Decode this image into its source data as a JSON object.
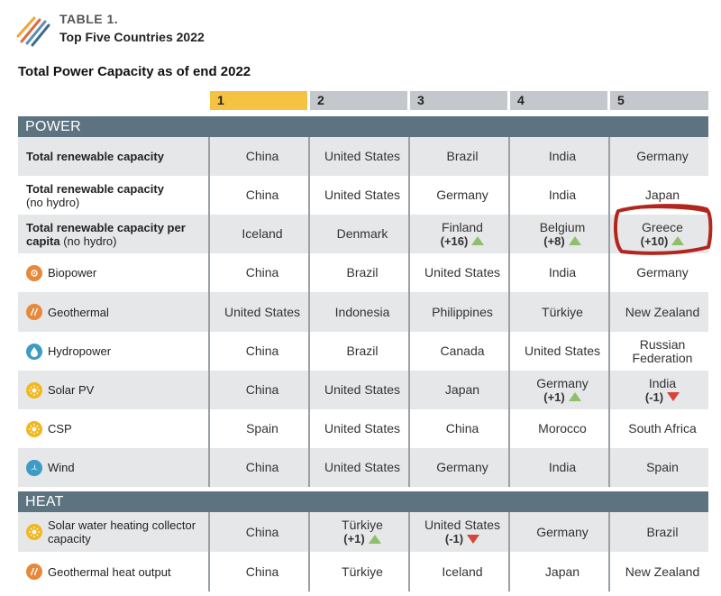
{
  "header": {
    "table_label": "TABLE 1.",
    "table_title": "Top Five Countries 2022",
    "subtitle": "Total Power Capacity as of end 2022"
  },
  "ranks": [
    "1",
    "2",
    "3",
    "4",
    "5"
  ],
  "sections": {
    "power": "POWER",
    "heat": "HEAT"
  },
  "power_rows": [
    {
      "label": "Total renewable capacity",
      "sub": "",
      "icon": "",
      "cells": [
        {
          "country": "China"
        },
        {
          "country": "United States"
        },
        {
          "country": "Brazil"
        },
        {
          "country": "India"
        },
        {
          "country": "Germany"
        }
      ]
    },
    {
      "label": "Total renewable capacity",
      "sub": "(no hydro)",
      "icon": "",
      "cells": [
        {
          "country": "China"
        },
        {
          "country": "United States"
        },
        {
          "country": "Germany"
        },
        {
          "country": "India"
        },
        {
          "country": "Japan"
        }
      ]
    },
    {
      "label": "Total renewable capacity per capita",
      "sub": "(no hydro)",
      "icon": "",
      "cells": [
        {
          "country": "Iceland"
        },
        {
          "country": "Denmark"
        },
        {
          "country": "Finland",
          "change": "(+16)",
          "dir": "up"
        },
        {
          "country": "Belgium",
          "change": "(+8)",
          "dir": "up"
        },
        {
          "country": "Greece",
          "change": "(+10)",
          "dir": "up"
        }
      ]
    },
    {
      "label": "Biopower",
      "sub": "",
      "icon": "biopower-icon",
      "cells": [
        {
          "country": "China"
        },
        {
          "country": "Brazil"
        },
        {
          "country": "United States"
        },
        {
          "country": "India"
        },
        {
          "country": "Germany"
        }
      ]
    },
    {
      "label": "Geothermal",
      "sub": "",
      "icon": "geothermal-icon",
      "cells": [
        {
          "country": "United States"
        },
        {
          "country": "Indonesia"
        },
        {
          "country": "Philippines"
        },
        {
          "country": "Türkiye"
        },
        {
          "country": "New Zealand"
        }
      ]
    },
    {
      "label": "Hydropower",
      "sub": "",
      "icon": "hydropower-icon",
      "cells": [
        {
          "country": "China"
        },
        {
          "country": "Brazil"
        },
        {
          "country": "Canada"
        },
        {
          "country": "United States"
        },
        {
          "country": "Russian Federation"
        }
      ]
    },
    {
      "label": "Solar PV",
      "sub": "",
      "icon": "solar-pv-icon",
      "cells": [
        {
          "country": "China"
        },
        {
          "country": "United States"
        },
        {
          "country": "Japan"
        },
        {
          "country": "Germany",
          "change": "(+1)",
          "dir": "up"
        },
        {
          "country": "India",
          "change": "(-1)",
          "dir": "down"
        }
      ]
    },
    {
      "label": "CSP",
      "sub": "",
      "icon": "csp-icon",
      "cells": [
        {
          "country": "Spain"
        },
        {
          "country": "United States"
        },
        {
          "country": "China"
        },
        {
          "country": "Morocco"
        },
        {
          "country": "South Africa"
        }
      ]
    },
    {
      "label": "Wind",
      "sub": "",
      "icon": "wind-icon",
      "cells": [
        {
          "country": "China"
        },
        {
          "country": "United States"
        },
        {
          "country": "Germany"
        },
        {
          "country": "India"
        },
        {
          "country": "Spain"
        }
      ]
    }
  ],
  "heat_rows": [
    {
      "label": "Solar water heating collector capacity",
      "sub": "",
      "icon": "solar-water-heating-icon",
      "cells": [
        {
          "country": "China"
        },
        {
          "country": "Türkiye",
          "change": "(+1)",
          "dir": "up"
        },
        {
          "country": "United States",
          "change": "(-1)",
          "dir": "down"
        },
        {
          "country": "Germany"
        },
        {
          "country": "Brazil"
        }
      ]
    },
    {
      "label": "Geothermal heat output",
      "sub": "",
      "icon": "geothermal-heat-icon",
      "cells": [
        {
          "country": "China"
        },
        {
          "country": "Türkiye"
        },
        {
          "country": "Iceland"
        },
        {
          "country": "Japan"
        },
        {
          "country": "New Zealand"
        }
      ]
    }
  ],
  "colors": {
    "rank_first": "#f5c242",
    "rank_other": "#c4c7cc",
    "section_header": "#5d7380",
    "row_shade": "#e6e7e8",
    "arrow_up": "#8fbf6a",
    "arrow_down": "#d9443a",
    "annotation": "#b3261e"
  }
}
